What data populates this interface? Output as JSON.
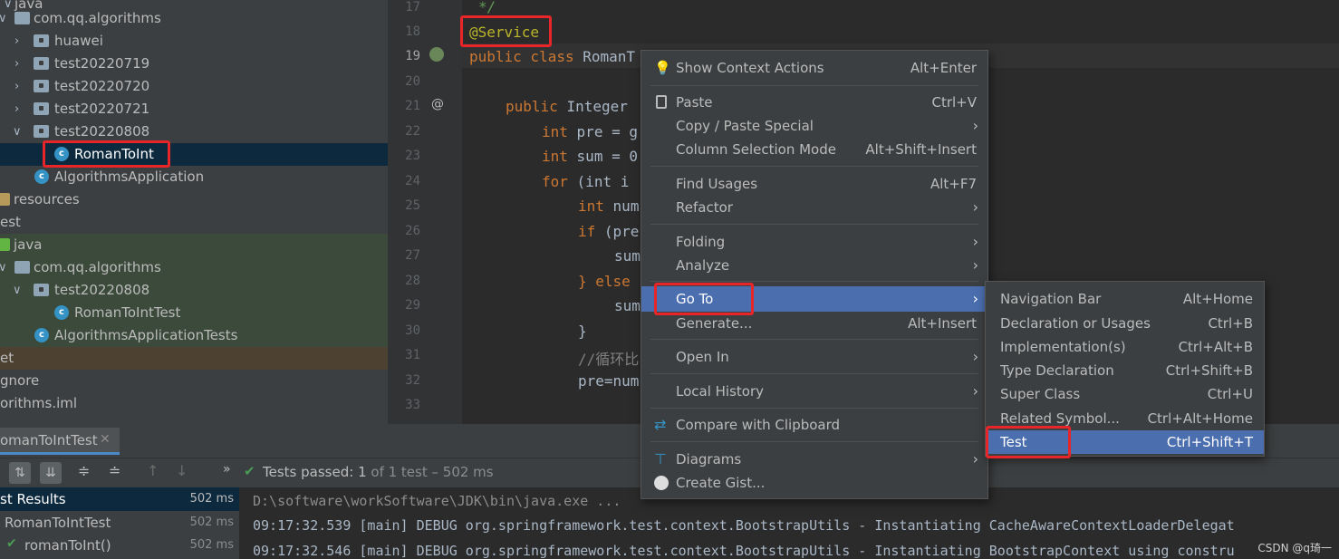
{
  "project_tree": {
    "rows": [
      {
        "label": "java",
        "icon": "folder-icon"
      },
      {
        "label": "com.qq.algorithms",
        "icon": "package-icon"
      },
      {
        "label": "huawei",
        "icon": "package-icon"
      },
      {
        "label": "test20220719",
        "icon": "package-icon"
      },
      {
        "label": "test20220720",
        "icon": "package-icon"
      },
      {
        "label": "test20220721",
        "icon": "package-icon"
      },
      {
        "label": "test20220808",
        "icon": "package-icon"
      },
      {
        "label": "RomanToInt",
        "icon": "class-icon"
      },
      {
        "label": "AlgorithmsApplication",
        "icon": "spring-class-icon"
      },
      {
        "label": "resources",
        "icon": "resources-folder-icon"
      },
      {
        "label": "est",
        "icon": ""
      },
      {
        "label": "java",
        "icon": "test-folder-icon"
      },
      {
        "label": "com.qq.algorithms",
        "icon": "package-icon"
      },
      {
        "label": "test20220808",
        "icon": "package-icon"
      },
      {
        "label": "RomanToIntTest",
        "icon": "test-class-icon"
      },
      {
        "label": "AlgorithmsApplicationTests",
        "icon": "test-class-icon"
      },
      {
        "label": "et",
        "icon": ""
      },
      {
        "label": "gnore",
        "icon": ""
      },
      {
        "label": "orithms.iml",
        "icon": ""
      }
    ]
  },
  "editor": {
    "lines": [
      {
        "n": "17",
        "text": "*/"
      },
      {
        "n": "18",
        "text": "@Service"
      },
      {
        "n": "19",
        "kw": "public class",
        "rest": "RomanT"
      },
      {
        "n": "20"
      },
      {
        "n": "21",
        "kw": "public",
        "rest": "Integer"
      },
      {
        "n": "22",
        "kw": "int",
        "rest": "pre = g"
      },
      {
        "n": "23",
        "kw": "int",
        "rest": "sum = 0"
      },
      {
        "n": "24",
        "kw": "for",
        "rest": "(int i"
      },
      {
        "n": "25",
        "kw": "int",
        "rest": "num"
      },
      {
        "n": "26",
        "kw": "if",
        "rest": "(pre"
      },
      {
        "n": "27",
        "rest": "sum"
      },
      {
        "n": "28",
        "rest": "} else"
      },
      {
        "n": "29",
        "rest": "sum"
      },
      {
        "n": "30",
        "rest": "}"
      },
      {
        "n": "31",
        "rest": "//循环比"
      },
      {
        "n": "32",
        "rest": "pre=num"
      },
      {
        "n": "33"
      }
    ],
    "gutter_marks": {
      "line21": "@"
    }
  },
  "context_menu": {
    "items": [
      {
        "label": "Show Context Actions",
        "shortcut": "Alt+Enter",
        "icon": "lightbulb-icon"
      },
      {
        "label": "Paste",
        "shortcut": "Ctrl+V",
        "icon": "clipboard-icon"
      },
      {
        "label": "Copy / Paste Special",
        "shortcut": "›"
      },
      {
        "label": "Column Selection Mode",
        "shortcut": "Alt+Shift+Insert"
      },
      {
        "label": "Find Usages",
        "shortcut": "Alt+F7"
      },
      {
        "label": "Refactor",
        "shortcut": "›"
      },
      {
        "label": "Folding",
        "shortcut": "›"
      },
      {
        "label": "Analyze",
        "shortcut": "›"
      },
      {
        "label": "Go To",
        "shortcut": "›"
      },
      {
        "label": "Generate...",
        "shortcut": "Alt+Insert"
      },
      {
        "label": "Open In",
        "shortcut": "›"
      },
      {
        "label": "Local History",
        "shortcut": "›"
      },
      {
        "label": "Compare with Clipboard",
        "shortcut": "",
        "icon": "compare-icon"
      },
      {
        "label": "Diagrams",
        "shortcut": "›",
        "icon": "diagram-icon"
      },
      {
        "label": "Create Gist...",
        "shortcut": "",
        "icon": "github-icon"
      }
    ]
  },
  "submenu": {
    "items": [
      {
        "label": "Navigation Bar",
        "shortcut": "Alt+Home"
      },
      {
        "label": "Declaration or Usages",
        "shortcut": "Ctrl+B"
      },
      {
        "label": "Implementation(s)",
        "shortcut": "Ctrl+Alt+B"
      },
      {
        "label": "Type Declaration",
        "shortcut": "Ctrl+Shift+B"
      },
      {
        "label": "Super Class",
        "shortcut": "Ctrl+U"
      },
      {
        "label": "Related Symbol...",
        "shortcut": "Ctrl+Alt+Home"
      },
      {
        "label": "Test",
        "shortcut": "Ctrl+Shift+T"
      }
    ]
  },
  "run_panel": {
    "tab_label": "omanToIntTest",
    "status_prefix": "Tests passed:",
    "status_count": "1",
    "status_rest": "of 1 test – 502 ms",
    "results": [
      {
        "label": "st Results",
        "time": "502 ms"
      },
      {
        "label": "RomanToIntTest",
        "time": "502 ms"
      },
      {
        "label": "romanToInt()",
        "time": "502 ms"
      }
    ],
    "console": [
      "D:\\software\\workSoftware\\JDK\\bin\\java.exe ...",
      "09:17:32.539 [main] DEBUG org.springframework.test.context.BootstrapUtils - Instantiating CacheAwareContextLoaderDelegat",
      "09:17:32.546 [main] DEBUG org.springframework.test.context.BootstrapUtils - Instantiating BootstrapContext using constru"
    ]
  },
  "watermark": "CSDN @q琦一"
}
